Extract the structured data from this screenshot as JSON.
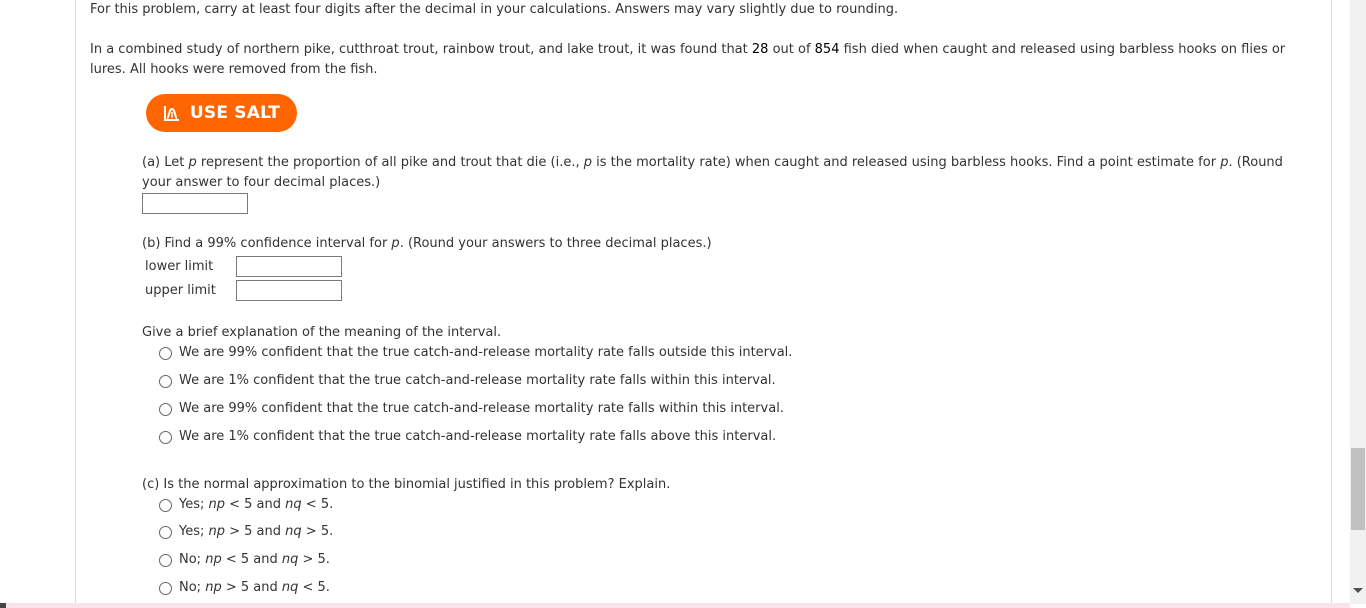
{
  "intro": "For this problem, carry at least four digits after the decimal in your calculations. Answers may vary slightly due to rounding.",
  "problem": {
    "line1_pre": "In a combined study of northern pike, cutthroat trout, rainbow trout, and lake trout, it was found that ",
    "died": "28",
    "line1_mid": " out of ",
    "total": "854",
    "line1_post": " fish died when caught and released using barbless hooks on flies or",
    "line2": "lures. All hooks were removed from the fish."
  },
  "salt_button": {
    "label": "USE SALT",
    "icon": "salt-chart-icon"
  },
  "part_a": {
    "line1_pre": "(a) Let ",
    "var1": "p",
    "line1_mid": " represent the proportion of all pike and trout that die (i.e., ",
    "var2": "p",
    "line1_mid2": " is the mortality rate) when caught and released using barbless hooks. Find a point estimate for ",
    "var3": "p",
    "line1_post": ". (Round",
    "line2": "your answer to four decimal places.)",
    "answer_value": ""
  },
  "part_b": {
    "prompt_pre": "(b) Find a 99% confidence interval for ",
    "var": "p",
    "prompt_post": ". (Round your answers to three decimal places.)",
    "lower_label": "lower limit",
    "upper_label": "upper limit",
    "lower_value": "",
    "upper_value": ""
  },
  "explanation": {
    "prompt": "Give a brief explanation of the meaning of the interval.",
    "options": [
      "We are 99% confident that the true catch-and-release mortality rate falls outside this interval.",
      "We are 1% confident that the true catch-and-release mortality rate falls within this interval.",
      "We are 99% confident that the true catch-and-release mortality rate falls within this interval.",
      "We are 1% confident that the true catch-and-release mortality rate falls above this interval."
    ]
  },
  "part_c": {
    "prompt": "(c) Is the normal approximation to the binomial justified in this problem? Explain.",
    "options": [
      {
        "lead": "Yes; ",
        "v1": "np",
        "r1": " < 5 and ",
        "v2": "nq",
        "r2": " < 5."
      },
      {
        "lead": "Yes; ",
        "v1": "np",
        "r1": " > 5 and ",
        "v2": "nq",
        "r2": " > 5."
      },
      {
        "lead": "No; ",
        "v1": "np",
        "r1": " < 5 and ",
        "v2": "nq",
        "r2": " > 5."
      },
      {
        "lead": "No; ",
        "v1": "np",
        "r1": " > 5 and ",
        "v2": "nq",
        "r2": " < 5."
      }
    ]
  },
  "colors": {
    "accent": "#ff6600",
    "text": "#333333"
  }
}
